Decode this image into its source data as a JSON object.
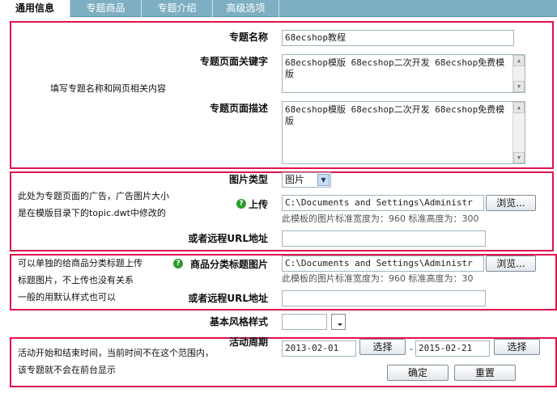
{
  "tabs": [
    {
      "label": "通用信息",
      "active": true
    },
    {
      "label": "专题商品",
      "active": false
    },
    {
      "label": "专题介绍",
      "active": false
    },
    {
      "label": "高级选项",
      "active": false
    }
  ],
  "annotations": {
    "name_section": "填写专题名称和网页相关内容",
    "ad_section_line1": "此处为专题页面的广告，广告图片大小",
    "ad_section_line2": "是在模版目录下的topic.dwt中修改的",
    "category_line1": "可以单独的给商品分类标题上传",
    "category_line2": "标题图片，不上传也没有关系",
    "category_line3": "一般的用默认样式也可以",
    "period_line1": "活动开始和结束时间，当前时间不在这个范围内，",
    "period_line2": "该专题就不会在前台显示"
  },
  "form": {
    "topic_name": {
      "label": "专题名称",
      "value": "68ecshop教程"
    },
    "keywords": {
      "label": "专题页面关键字",
      "value": "68ecshop模版 68ecshop二次开发 68ecshop免费模版"
    },
    "description": {
      "label": "专题页面描述",
      "value": "68ecshop模版 68ecshop二次开发 68ecshop免费模版"
    },
    "image_type": {
      "label": "图片类型",
      "value": "图片"
    },
    "upload": {
      "label": "上传",
      "value": "C:\\Documents and Settings\\Administr",
      "browse": "浏览...",
      "hint": "此模板的图片标准宽度为：960 标准高度为：300"
    },
    "remote_url": {
      "label": "或者远程URL地址",
      "value": ""
    },
    "category_title_image": {
      "label": "商品分类标题图片",
      "value": "C:\\Documents and Settings\\Administr",
      "browse": "浏览...",
      "hint": "此模板的图片标准宽度为：960 标准高度为：30"
    },
    "category_remote_url": {
      "label": "或者远程URL地址",
      "value": ""
    },
    "base_style": {
      "label": "基本风格样式",
      "value": ""
    },
    "period": {
      "label": "活动周期",
      "start": "2013-02-01",
      "end": "2015-02-21",
      "select_label": "选择",
      "separator": "-"
    },
    "confirm_label": "确定",
    "reset_label": "重置"
  },
  "help_icon_glyph": "?",
  "colors": {
    "tab_bar": "#7eaec1",
    "highlight_box": "#e0144c",
    "help_icon": "#2e9a2a"
  }
}
